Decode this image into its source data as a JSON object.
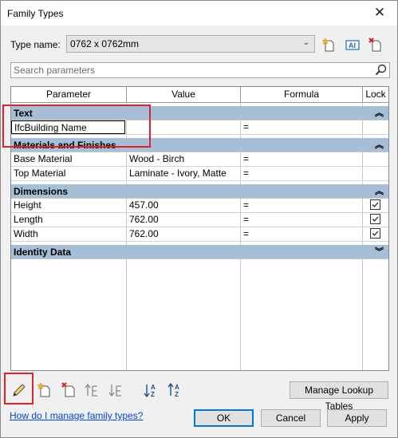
{
  "window": {
    "title": "Family Types",
    "close_glyph": "✕"
  },
  "type_name": {
    "label": "Type name:",
    "value": "0762 x 0762mm"
  },
  "toolbar_icons": [
    "new-type-icon",
    "rename-type-icon",
    "delete-type-icon"
  ],
  "search": {
    "placeholder": "Search parameters"
  },
  "grid": {
    "headers": {
      "parameter": "Parameter",
      "value": "Value",
      "formula": "Formula",
      "lock": "Lock"
    },
    "groups": [
      {
        "name": "Text",
        "state": "expanded",
        "rows": [
          {
            "parameter": "IfcBuilding Name",
            "value": "",
            "formula": "=",
            "lock": null,
            "editing": true
          }
        ]
      },
      {
        "name": "Materials and Finishes",
        "state": "expanded",
        "rows": [
          {
            "parameter": "Base Material",
            "value": "Wood - Birch",
            "formula": "=",
            "lock": null
          },
          {
            "parameter": "Top Material",
            "value": "Laminate - Ivory, Matte",
            "formula": "=",
            "lock": null
          }
        ]
      },
      {
        "name": "Dimensions",
        "state": "expanded",
        "rows": [
          {
            "parameter": "Height",
            "value": "457.00",
            "formula": "=",
            "lock": true
          },
          {
            "parameter": "Length",
            "value": "762.00",
            "formula": "=",
            "lock": true
          },
          {
            "parameter": "Width",
            "value": "762.00",
            "formula": "=",
            "lock": true
          }
        ]
      },
      {
        "name": "Identity Data",
        "state": "collapsed",
        "rows": []
      }
    ]
  },
  "bottom_toolbar": {
    "icons": [
      "edit-parameter-icon",
      "new-parameter-icon",
      "delete-parameter-icon",
      "move-up-icon",
      "move-down-icon",
      "sort-ascending-icon",
      "sort-descending-icon"
    ],
    "lookup_button": "Manage Lookup Tables"
  },
  "help_link": "How do I manage family types?",
  "buttons": {
    "ok": "OK",
    "cancel": "Cancel",
    "apply": "Apply"
  },
  "colors": {
    "group_header": "#a6bed6",
    "highlight": "#e0202a",
    "link": "#0645d6"
  }
}
